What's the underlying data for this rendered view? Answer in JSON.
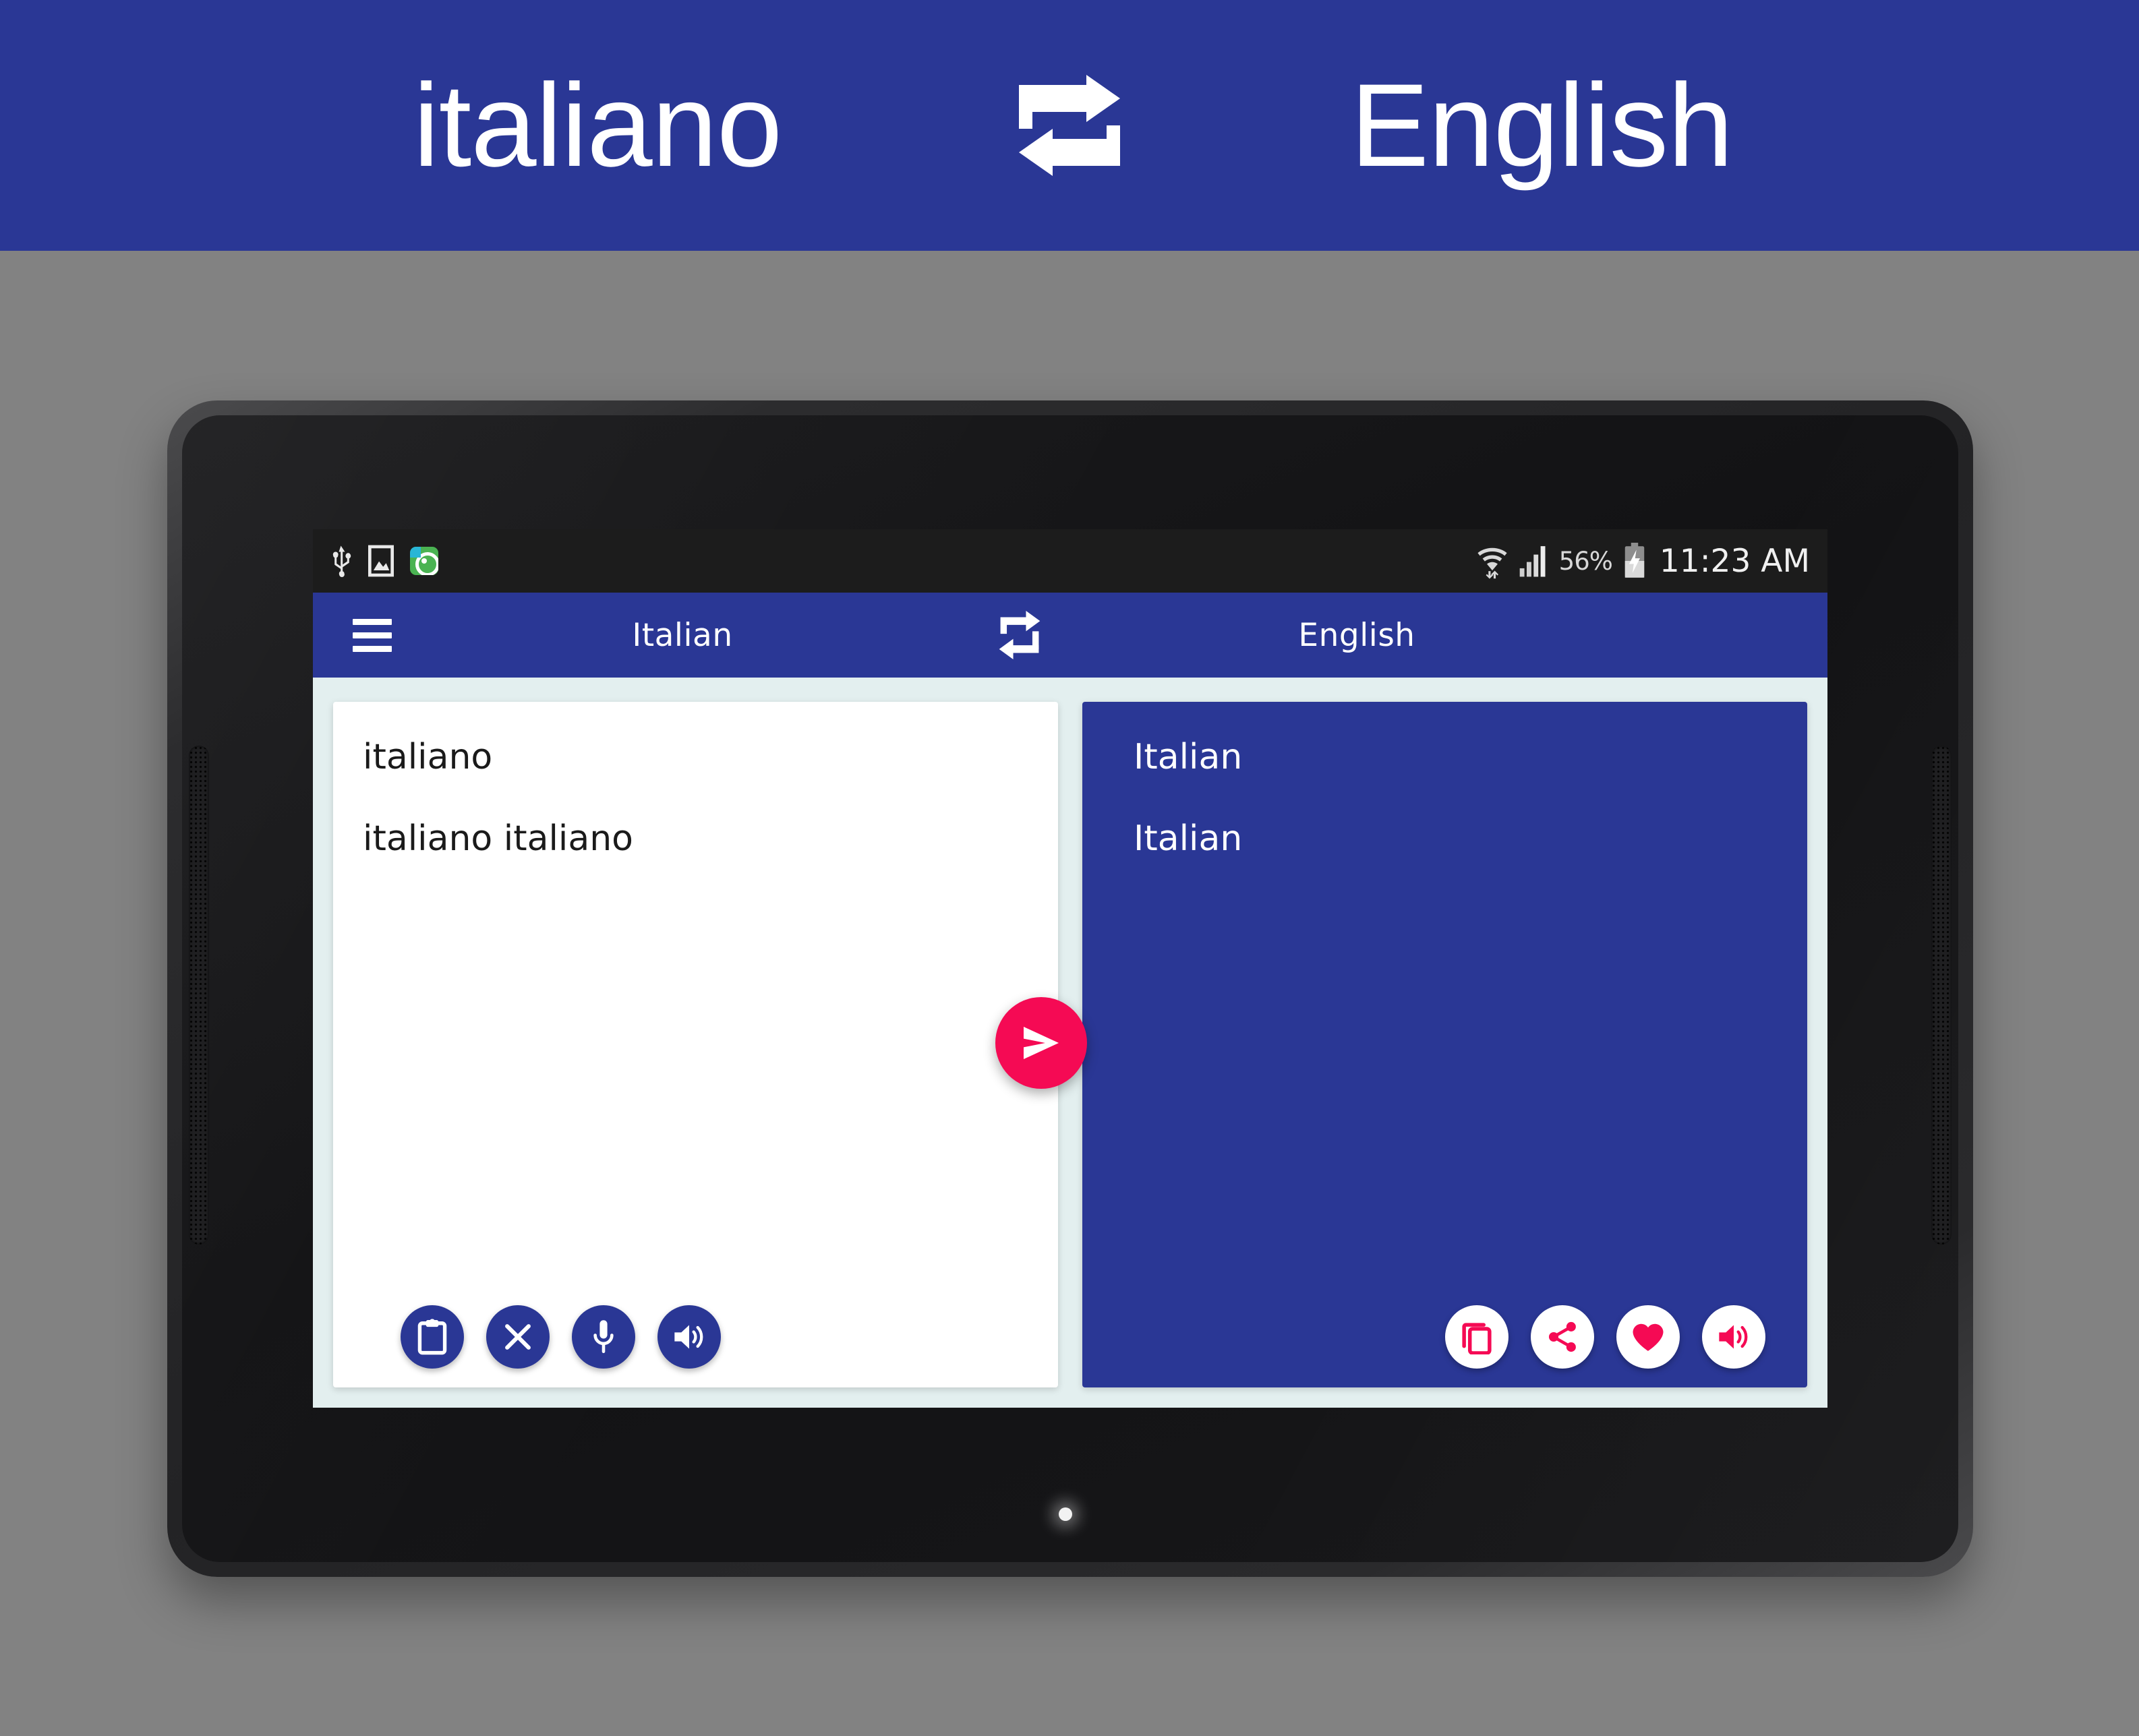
{
  "promo": {
    "source_language": "italiano",
    "target_language": "English",
    "swap_icon": "swap-horizontal-icon",
    "background_color": "#2A3795",
    "text_color": "#FFFFFF"
  },
  "device": {
    "type": "android-tablet",
    "bezel_color": "#232325",
    "front_camera_icon": "front-camera",
    "sensor_icon": "ambient-light-sensor",
    "led_icon": "notification-led"
  },
  "statusbar": {
    "left_icons": [
      {
        "name": "usb-icon",
        "glyph": "usb"
      },
      {
        "name": "screenshot-icon",
        "glyph": "image"
      },
      {
        "name": "app-notification-icon",
        "glyph": "green-circle-app"
      }
    ],
    "right_icons": [
      {
        "name": "wifi-icon",
        "glyph": "wifi-transfer"
      },
      {
        "name": "cellular-signal-icon",
        "glyph": "signal-bars"
      }
    ],
    "battery_percent": "56%",
    "battery_icon": "battery-charging-icon",
    "time": "11:23 AM"
  },
  "toolbar": {
    "menu_icon": "hamburger-menu-icon",
    "source_language": "Italian",
    "swap_icon": "swap-horizontal-icon",
    "target_language": "English",
    "background_color": "#2A3795"
  },
  "source_panel": {
    "background_color": "#FFFFFF",
    "text_color": "#1A1A1A",
    "lines": [
      "italiano",
      "",
      "italiano",
      "italiano"
    ],
    "actions": [
      {
        "name": "paste-button",
        "icon": "clipboard-paste-icon",
        "label": "Paste"
      },
      {
        "name": "clear-button",
        "icon": "close-x-icon",
        "label": "Clear"
      },
      {
        "name": "voice-input-button",
        "icon": "microphone-icon",
        "label": "Speak"
      },
      {
        "name": "speak-source-button",
        "icon": "volume-speaker-icon",
        "label": "Listen"
      }
    ],
    "action_fill": "#2A3795",
    "action_icon_color": "#FFFFFF"
  },
  "target_panel": {
    "background_color": "#2A3795",
    "text_color": "#FFFFFF",
    "lines": [
      "Italian",
      "",
      "Italian"
    ],
    "actions": [
      {
        "name": "copy-button",
        "icon": "copy-icon",
        "label": "Copy"
      },
      {
        "name": "share-button",
        "icon": "share-icon",
        "label": "Share"
      },
      {
        "name": "favorite-button",
        "icon": "heart-icon",
        "label": "Favorite"
      },
      {
        "name": "speak-target-button",
        "icon": "volume-speaker-icon",
        "label": "Listen"
      }
    ],
    "action_fill": "#FFFFFF",
    "action_icon_color": "#F50A54"
  },
  "translate_button": {
    "name": "translate-button",
    "icon": "send-arrow-icon",
    "color": "#F50A54",
    "icon_color": "#FFFFFF"
  },
  "colors": {
    "brand_blue": "#2A3795",
    "accent_pink": "#F50A54",
    "panel_backdrop": "#E3EFEF",
    "page_background": "#828282"
  }
}
